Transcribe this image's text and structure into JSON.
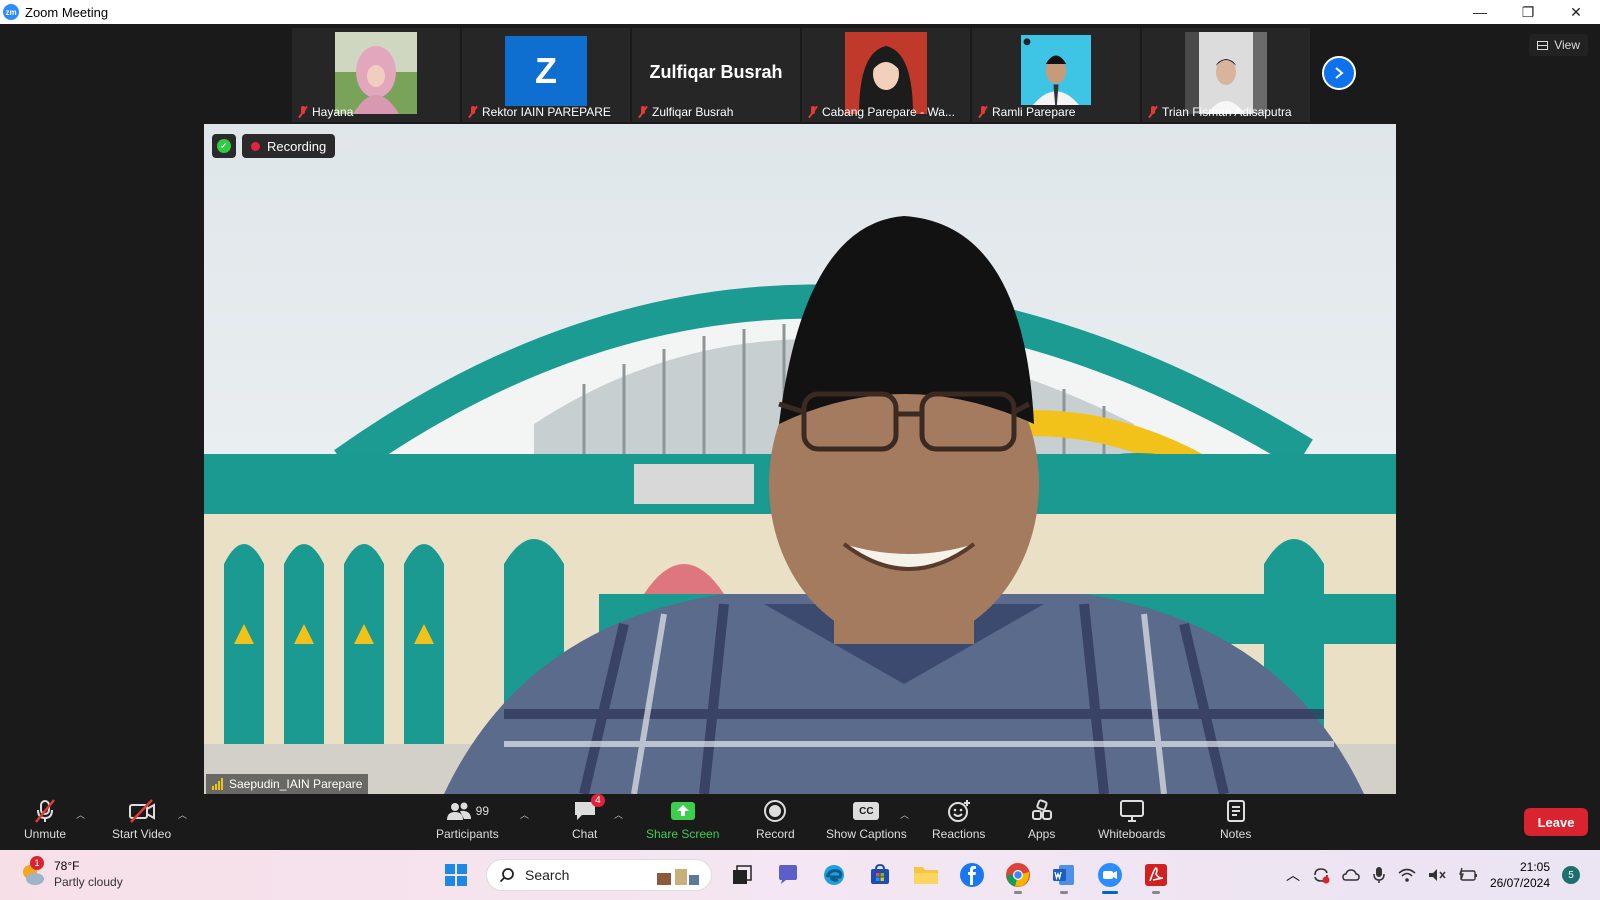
{
  "window": {
    "app_logo": "zm",
    "title": "Zoom Meeting",
    "controls": [
      "—",
      "❐",
      "✕"
    ]
  },
  "view_button": {
    "label": "View"
  },
  "thumbnails": [
    {
      "name": "Hayana",
      "type": "photo",
      "color": "#d6a7b6"
    },
    {
      "name": "Rektor IAIN PAREPARE",
      "type": "letter",
      "letter": "Z"
    },
    {
      "name": "Zulfiqar Busrah",
      "type": "name",
      "display": "Zulfiqar Busrah"
    },
    {
      "name": "Cabang Parepare - Wa...",
      "type": "photo",
      "color": "#c0392b"
    },
    {
      "name": "Ramli Parepare",
      "type": "photo",
      "color": "#3ec5e6"
    },
    {
      "name": "Trian Fisman Adisaputra",
      "type": "photo",
      "color": "#dcdcdc"
    }
  ],
  "main_video": {
    "recording_label": "Recording",
    "speaker_name": "Saepudin_IAIN Parepare"
  },
  "toolbar": {
    "unmute": "Unmute",
    "start_video": "Start Video",
    "participants": "Participants",
    "participants_count": "99",
    "chat": "Chat",
    "chat_badge": "4",
    "share_screen": "Share Screen",
    "record": "Record",
    "show_captions": "Show Captions",
    "captions_icon": "CC",
    "reactions": "Reactions",
    "apps": "Apps",
    "whiteboards": "Whiteboards",
    "notes": "Notes",
    "leave": "Leave"
  },
  "taskbar": {
    "weather_temp": "78°F",
    "weather_desc": "Partly cloudy",
    "weather_badge": "1",
    "search_label": "Search",
    "time": "21:05",
    "date": "26/07/2024",
    "notifications": "5"
  },
  "colors": {
    "accent": "#0e72ed",
    "leave": "#d9242f",
    "share_green": "#3ccf4e",
    "record_red": "#e0243b"
  }
}
